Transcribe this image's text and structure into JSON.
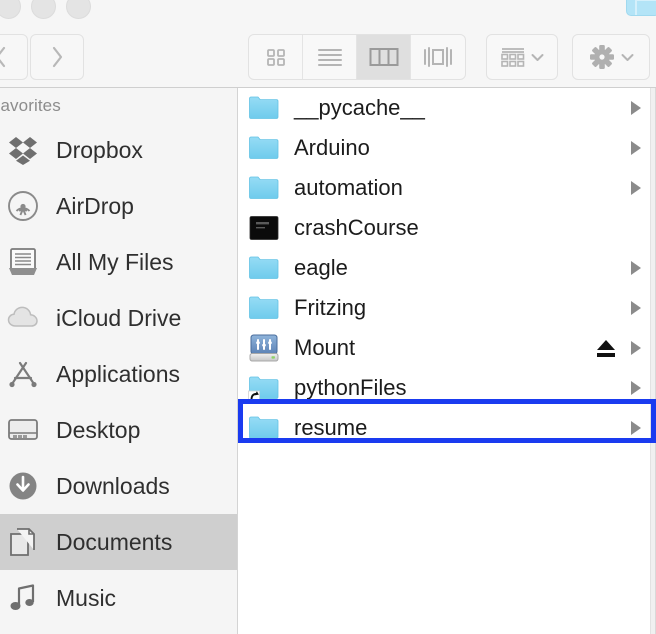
{
  "window": {
    "traffic_lights": [
      "close",
      "minimize",
      "zoom"
    ],
    "corner_highlight": "highlighted-control"
  },
  "toolbar": {
    "back_label": "Back",
    "forward_label": "Forward",
    "view_modes": [
      {
        "id": "icon",
        "label": "Icon View",
        "icon": "icon-view-icon",
        "active": false
      },
      {
        "id": "list",
        "label": "List View",
        "icon": "list-view-icon",
        "active": false
      },
      {
        "id": "column",
        "label": "Column View",
        "icon": "column-view-icon",
        "active": true
      },
      {
        "id": "coverflow",
        "label": "Cover Flow View",
        "icon": "coverflow-view-icon",
        "active": false
      }
    ],
    "arrange_label": "Arrange By",
    "arrange_icon": "arrange-grid-icon",
    "action_label": "Action",
    "action_icon": "gear-icon",
    "dropdown_icon": "chevron-down-icon"
  },
  "sidebar": {
    "header": "Favorites",
    "items": [
      {
        "label": "Dropbox",
        "icon": "dropbox-icon",
        "selected": false
      },
      {
        "label": "AirDrop",
        "icon": "airdrop-icon",
        "selected": false
      },
      {
        "label": "All My Files",
        "icon": "all-my-files-icon",
        "selected": false
      },
      {
        "label": "iCloud Drive",
        "icon": "icloud-icon",
        "selected": false
      },
      {
        "label": "Applications",
        "icon": "applications-icon",
        "selected": false
      },
      {
        "label": "Desktop",
        "icon": "desktop-icon",
        "selected": false
      },
      {
        "label": "Downloads",
        "icon": "downloads-icon",
        "selected": false
      },
      {
        "label": "Documents",
        "icon": "documents-icon",
        "selected": true
      },
      {
        "label": "Music",
        "icon": "music-icon",
        "selected": false
      }
    ]
  },
  "file_column": {
    "rows": [
      {
        "name": "__pycache__",
        "icon": "folder-icon",
        "has_chevron": true,
        "eject": false,
        "alias": false,
        "annotated": false
      },
      {
        "name": "Arduino",
        "icon": "folder-icon",
        "has_chevron": true,
        "eject": false,
        "alias": false,
        "annotated": false
      },
      {
        "name": "automation",
        "icon": "folder-icon",
        "has_chevron": true,
        "eject": false,
        "alias": false,
        "annotated": false
      },
      {
        "name": "crashCourse",
        "icon": "terminal-file-icon",
        "has_chevron": false,
        "eject": false,
        "alias": false,
        "annotated": false
      },
      {
        "name": "eagle",
        "icon": "folder-icon",
        "has_chevron": true,
        "eject": false,
        "alias": false,
        "annotated": false
      },
      {
        "name": "Fritzing",
        "icon": "folder-icon",
        "has_chevron": true,
        "eject": false,
        "alias": false,
        "annotated": false
      },
      {
        "name": "Mount",
        "icon": "network-drive-icon",
        "has_chevron": true,
        "eject": true,
        "alias": false,
        "annotated": true
      },
      {
        "name": "pythonFiles",
        "icon": "folder-alias-icon",
        "has_chevron": true,
        "eject": false,
        "alias": true,
        "annotated": false
      },
      {
        "name": "resume",
        "icon": "folder-icon",
        "has_chevron": true,
        "eject": false,
        "alias": false,
        "annotated": false
      }
    ],
    "eject_icon": "eject-icon",
    "chevron_icon": "chevron-right-icon"
  },
  "colors": {
    "folder_blue": "#7FD3F0",
    "annotation_blue": "#1A3BF0",
    "sidebar_bg": "#F5F5F5",
    "selected_row": "#CFCFCF",
    "toolbar_bg": "#F6F6F6"
  }
}
